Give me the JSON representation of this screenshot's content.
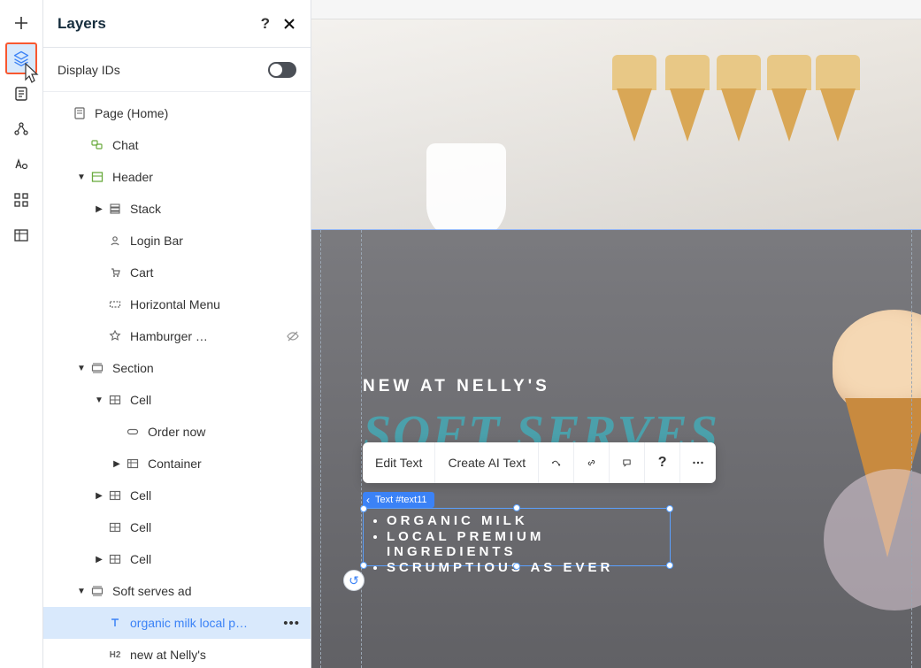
{
  "panel": {
    "title": "Layers",
    "display_ids_label": "Display IDs"
  },
  "tree": [
    {
      "depth": 0,
      "arrow": "",
      "icon": "page",
      "label": "Page (Home)"
    },
    {
      "depth": 1,
      "arrow": "",
      "icon": "chat",
      "label": "Chat"
    },
    {
      "depth": 1,
      "arrow": "down",
      "icon": "section-green",
      "label": "Header"
    },
    {
      "depth": 2,
      "arrow": "right",
      "icon": "stack",
      "label": "Stack"
    },
    {
      "depth": 2,
      "arrow": "",
      "icon": "login",
      "label": "Login Bar"
    },
    {
      "depth": 2,
      "arrow": "",
      "icon": "cart",
      "label": "Cart"
    },
    {
      "depth": 2,
      "arrow": "",
      "icon": "hmenu",
      "label": "Horizontal Menu"
    },
    {
      "depth": 2,
      "arrow": "",
      "icon": "star",
      "label": "Hamburger …",
      "hidden": true
    },
    {
      "depth": 1,
      "arrow": "down",
      "icon": "section",
      "label": "Section"
    },
    {
      "depth": 2,
      "arrow": "down",
      "icon": "cell",
      "label": "Cell"
    },
    {
      "depth": 3,
      "arrow": "",
      "icon": "button",
      "label": "Order now"
    },
    {
      "depth": 3,
      "arrow": "right",
      "icon": "container",
      "label": "Container"
    },
    {
      "depth": 2,
      "arrow": "right",
      "icon": "cell",
      "label": "Cell"
    },
    {
      "depth": 2,
      "arrow": "",
      "icon": "cell",
      "label": "Cell"
    },
    {
      "depth": 2,
      "arrow": "right",
      "icon": "cell",
      "label": "Cell"
    },
    {
      "depth": 1,
      "arrow": "down",
      "icon": "section",
      "label": "Soft serves ad"
    },
    {
      "depth": 2,
      "arrow": "",
      "icon": "text",
      "label": "organic milk local p…",
      "selected": true,
      "actions": true
    },
    {
      "depth": 2,
      "arrow": "",
      "icon": "h2",
      "label": "new at Nelly's"
    }
  ],
  "canvas": {
    "kicker": "NEW AT NELLY'S",
    "heading": "SOFT SERVES",
    "badge": "Text #text11",
    "bullets": [
      "organic milk",
      "local premium ingredients",
      "scrumptious as ever"
    ]
  },
  "floating_toolbar": {
    "edit_text": "Edit Text",
    "create_ai_text": "Create AI Text"
  }
}
